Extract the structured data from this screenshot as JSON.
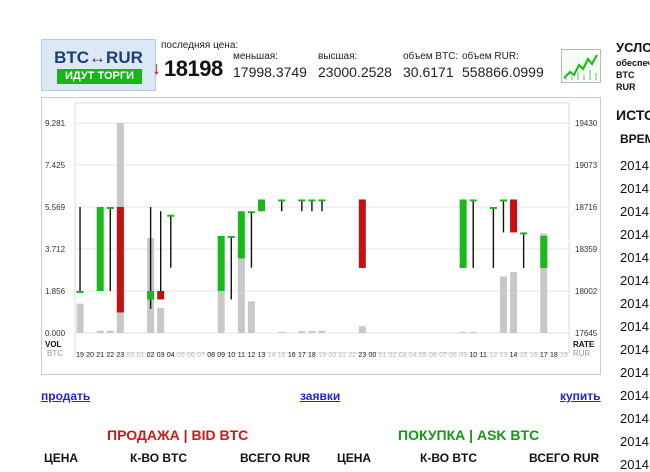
{
  "ticker": {
    "pair": "BTC↔RUR",
    "status": "ИДУТ ТОРГИ",
    "last_price_label": "последняя цена:",
    "last_price": "18198",
    "trend_arrow": "↓",
    "stats": [
      {
        "label": "меньшая:",
        "value": "17998.3749"
      },
      {
        "label": "высшая:",
        "value": "23000.2528"
      },
      {
        "label": "объем BTC:",
        "value": "30.6171"
      },
      {
        "label": "объем RUR:",
        "value": "558866.0999"
      }
    ]
  },
  "right_panel": {
    "heading": "УСЛО",
    "sub1": "обеспеч",
    "sub2": "BTC",
    "sub3": "RUR",
    "history_heading": "ИСТО",
    "time_header": "ВРЕМ",
    "rows": [
      "2014",
      "2014",
      "2014",
      "2014",
      "2014",
      "2014",
      "2014",
      "2014",
      "2014",
      "2014",
      "2014",
      "2014",
      "2014",
      "2014"
    ]
  },
  "actions": {
    "sell": "продать",
    "orders": "заявки",
    "buy": "купить"
  },
  "orderbook": {
    "sell_title": "ПРОДАЖА | BID BTC",
    "buy_title": "ПОКУПКА | ASK BTC",
    "columns": [
      "ЦЕНА",
      "К-ВО BTC",
      "ВСЕГО RUR"
    ]
  },
  "colors": {
    "up": "#19b919",
    "down": "#c41212",
    "volume": "#c8c8c8",
    "sell_title": "#d01818",
    "buy_title": "#139a13",
    "link": "#2525c8"
  },
  "chart_data": {
    "type": "candlestick",
    "vol_label": "VOL",
    "vol_unit": "BTC",
    "rate_label": "RATE",
    "rate_unit": "RUR",
    "vol_ticks": [
      "9.281",
      "7.425",
      "5.569",
      "3.712",
      "1.856",
      "0.000"
    ],
    "rate_ticks": [
      "19430",
      "19073",
      "18716",
      "18359",
      "18002",
      "17645"
    ],
    "x_labels": [
      "19",
      "20",
      "21",
      "22",
      "23",
      "00",
      "01",
      "02",
      "03",
      "04",
      "05",
      "06",
      "07",
      "08",
      "09",
      "10",
      "11",
      "12",
      "13",
      "14",
      "15",
      "16",
      "17",
      "18",
      "19",
      "20",
      "21",
      "22",
      "23",
      "00",
      "01",
      "02",
      "03",
      "04",
      "05",
      "06",
      "07",
      "08",
      "09",
      "10",
      "11",
      "12",
      "13",
      "14",
      "15",
      "16",
      "17",
      "18",
      "19"
    ],
    "x_label_dim": [
      0,
      0,
      0,
      0,
      0,
      1,
      1,
      0,
      0,
      0,
      1,
      1,
      1,
      0,
      0,
      0,
      0,
      0,
      0,
      1,
      1,
      0,
      0,
      0,
      1,
      1,
      1,
      1,
      0,
      0,
      1,
      1,
      1,
      1,
      1,
      1,
      1,
      1,
      1,
      0,
      0,
      1,
      1,
      0,
      1,
      1,
      0,
      0,
      1
    ],
    "candles": [
      {
        "i": 0,
        "open": 18002,
        "close": 18002,
        "high": 18716,
        "low": 18002,
        "vol": 1.3
      },
      {
        "i": 2,
        "open": 18002,
        "close": 18716,
        "high": 18716,
        "low": 18002,
        "vol": 0.1
      },
      {
        "i": 3,
        "open": 18716,
        "close": 18716,
        "high": 18716,
        "low": 18002,
        "vol": 0.1
      },
      {
        "i": 4,
        "open": 18716,
        "close": 17820,
        "high": 18716,
        "low": 17820,
        "vol": 9.28
      },
      {
        "i": 7,
        "open": 17930,
        "close": 18002,
        "high": 18716,
        "low": 17850,
        "vol": 4.2
      },
      {
        "i": 8,
        "open": 18002,
        "close": 17930,
        "high": 18680,
        "low": 17930,
        "vol": 1.1
      },
      {
        "i": 9,
        "open": 18650,
        "close": 18650,
        "high": 18650,
        "low": 18200,
        "vol": 0
      },
      {
        "i": 14,
        "open": 18002,
        "close": 18470,
        "high": 18470,
        "low": 18002,
        "vol": 2.3
      },
      {
        "i": 15,
        "open": 18470,
        "close": 18470,
        "high": 18470,
        "low": 17930,
        "vol": 0
      },
      {
        "i": 16,
        "open": 18280,
        "close": 18680,
        "high": 18680,
        "low": 18280,
        "vol": 3.8
      },
      {
        "i": 17,
        "open": 18680,
        "close": 18680,
        "high": 18680,
        "low": 18200,
        "vol": 1.4
      },
      {
        "i": 18,
        "open": 18680,
        "close": 18780,
        "high": 18780,
        "low": 18680,
        "vol": 0
      },
      {
        "i": 20,
        "open": 18780,
        "close": 18780,
        "high": 18780,
        "low": 18680,
        "vol": 0.05
      },
      {
        "i": 22,
        "open": 18780,
        "close": 18780,
        "high": 18780,
        "low": 18680,
        "vol": 0.08
      },
      {
        "i": 23,
        "open": 18780,
        "close": 18780,
        "high": 18780,
        "low": 18680,
        "vol": 0.08
      },
      {
        "i": 24,
        "open": 18780,
        "close": 18780,
        "high": 18780,
        "low": 18680,
        "vol": 0.1
      },
      {
        "i": 28,
        "open": 18780,
        "close": 18198,
        "high": 18780,
        "low": 18198,
        "vol": 0.3
      },
      {
        "i": 38,
        "open": 18198,
        "close": 18780,
        "high": 18780,
        "low": 18198,
        "vol": 0.05
      },
      {
        "i": 39,
        "open": 18780,
        "close": 18780,
        "high": 18780,
        "low": 18198,
        "vol": 0.05
      },
      {
        "i": 41,
        "open": 18716,
        "close": 18716,
        "high": 18716,
        "low": 18198,
        "vol": 0
      },
      {
        "i": 42,
        "open": 18780,
        "close": 18780,
        "high": 18780,
        "low": 18500,
        "vol": 2.5
      },
      {
        "i": 43,
        "open": 18780,
        "close": 18500,
        "high": 18780,
        "low": 18500,
        "vol": 2.7
      },
      {
        "i": 44,
        "open": 18500,
        "close": 18500,
        "high": 18500,
        "low": 18198,
        "vol": 0
      },
      {
        "i": 46,
        "open": 18198,
        "close": 18470,
        "high": 18470,
        "low": 18198,
        "vol": 4.4
      }
    ]
  }
}
